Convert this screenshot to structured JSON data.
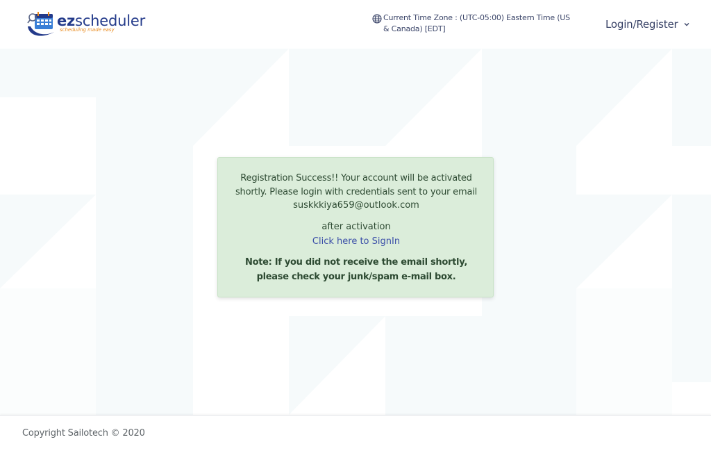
{
  "header": {
    "logo": {
      "prefix": "ez",
      "name": "scheduler",
      "tagline": "scheduling made easy",
      "icon": "calendar-logo-icon"
    },
    "timezone": {
      "icon": "globe-icon",
      "text": "Current Time Zone : (UTC-05:00) Eastern Time (US & Canada) [EDT]"
    },
    "account_menu": {
      "label": "Login/Register",
      "icon": "chevron-down-icon"
    }
  },
  "alert": {
    "message": "Registration Success!! Your account will be activated shortly. Please login with credentials sent to your email",
    "email": "suskkkiya659@outlook.com",
    "after_text": "after activation",
    "signin_link": "Click here to SignIn",
    "note": "Note: If you did not receive the email shortly, please check your junk/spam e-mail box."
  },
  "footer": {
    "copyright": "Copyright Sailotech © 2020"
  },
  "colors": {
    "brand_blue": "#233a8a",
    "brand_orange": "#e98a1d",
    "alert_bg": "#dbedda",
    "alert_text": "#2d4a32",
    "link": "#3b4fa8"
  }
}
